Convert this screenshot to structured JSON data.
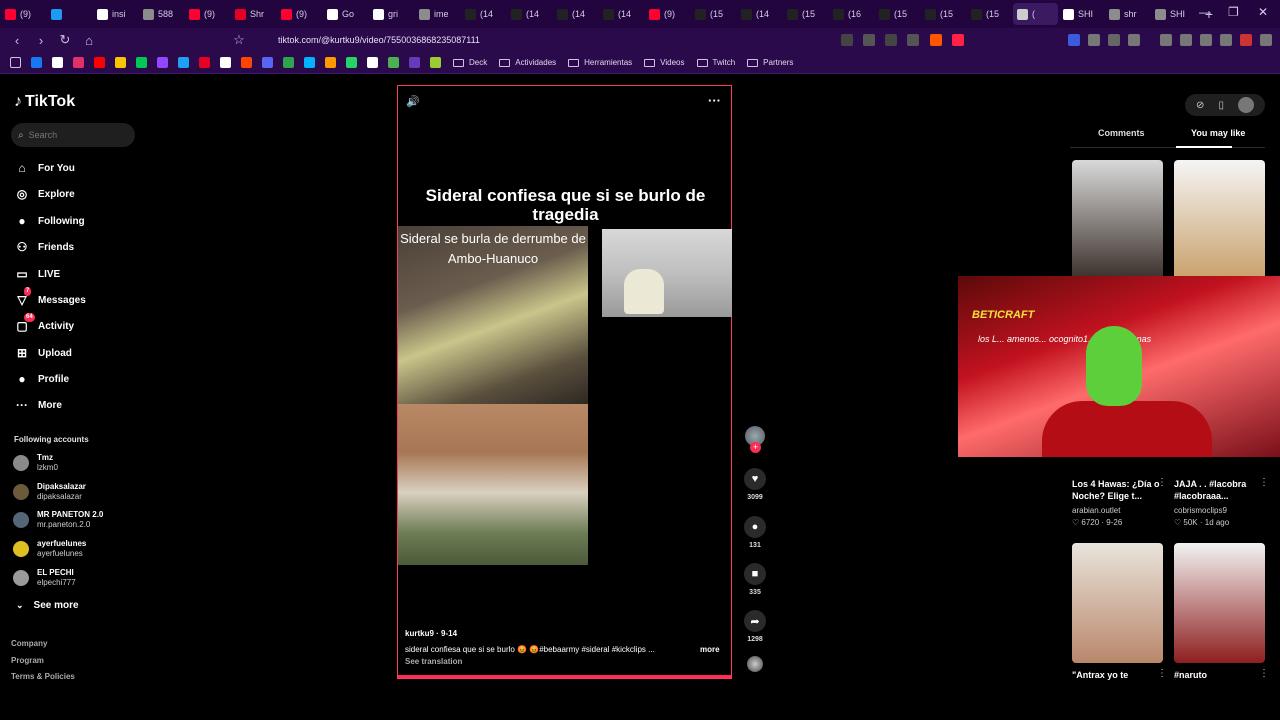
{
  "browser": {
    "tabs": [
      {
        "label": "(9)",
        "color": "#ff0033",
        "active": false
      },
      {
        "label": "",
        "color": "#1d9bf0",
        "active": false
      },
      {
        "label": "insi",
        "color": "#ffffff",
        "active": false
      },
      {
        "label": "588",
        "color": "#8c8c8c",
        "active": false
      },
      {
        "label": "(9)",
        "color": "#ff0033",
        "active": false
      },
      {
        "label": "Shr",
        "color": "#e60023",
        "active": false
      },
      {
        "label": "(9)",
        "color": "#ff0033",
        "active": false
      },
      {
        "label": "Go",
        "color": "#ffffff",
        "active": false
      },
      {
        "label": "gri",
        "color": "#ffffff",
        "active": false
      },
      {
        "label": "ime",
        "color": "#8c8c8c",
        "active": false
      },
      {
        "label": "(14",
        "color": "#222222",
        "active": false
      },
      {
        "label": "(14",
        "color": "#222222",
        "active": false
      },
      {
        "label": "(14",
        "color": "#222222",
        "active": false
      },
      {
        "label": "(14",
        "color": "#222222",
        "active": false
      },
      {
        "label": "(9)",
        "color": "#ff0033",
        "active": false
      },
      {
        "label": "(15",
        "color": "#222222",
        "active": false
      },
      {
        "label": "(14",
        "color": "#222222",
        "active": false
      },
      {
        "label": "(15",
        "color": "#222222",
        "active": false
      },
      {
        "label": "(16",
        "color": "#222222",
        "active": false
      },
      {
        "label": "(15",
        "color": "#222222",
        "active": false
      },
      {
        "label": "(15",
        "color": "#222222",
        "active": false
      },
      {
        "label": "(15",
        "color": "#222222",
        "active": false
      },
      {
        "label": "(",
        "color": "#cccccc",
        "active": true
      },
      {
        "label": "SHI",
        "color": "#ffffff",
        "active": false
      },
      {
        "label": "shr",
        "color": "#8c8c8c",
        "active": false
      },
      {
        "label": "SHI",
        "color": "#8c8c8c",
        "active": false
      }
    ],
    "new_tab": "+",
    "window_controls": {
      "minimize": "—",
      "restore": "❐",
      "close": "✕"
    },
    "url": "tiktok.com/@kurtku9/video/7550036868235087111",
    "bookmarks_icons": [
      "#1877f2",
      "#ffffff",
      "#e1306c",
      "#ff0000",
      "#f7c600",
      "#00c853",
      "#9146ff",
      "#1da1f2",
      "#e60023",
      "#ffffff",
      "#ff4500",
      "#5865f2",
      "#2ea44f",
      "#00b2ff",
      "#ff9900",
      "#25d366",
      "#ffffff",
      "#4caf50",
      "#673ab7",
      "#9acd32"
    ],
    "bookmark_folders": [
      "Deck",
      "Actividades",
      "Herramientas",
      "Videos",
      "Twitch",
      "Partners"
    ]
  },
  "tiktok": {
    "logo": "TikTok",
    "search_placeholder": "Search",
    "nav": [
      {
        "label": "For You",
        "icon": "⌂",
        "badge": ""
      },
      {
        "label": "Explore",
        "icon": "◎",
        "badge": ""
      },
      {
        "label": "Following",
        "icon": "●",
        "badge": ""
      },
      {
        "label": "Friends",
        "icon": "⚇",
        "badge": ""
      },
      {
        "label": "LIVE",
        "icon": "▭",
        "badge": ""
      },
      {
        "label": "Messages",
        "icon": "▽",
        "badge": "7"
      },
      {
        "label": "Activity",
        "icon": "▢",
        "badge": "64"
      },
      {
        "label": "Upload",
        "icon": "⊞",
        "badge": ""
      },
      {
        "label": "Profile",
        "icon": "●",
        "badge": ""
      },
      {
        "label": "More",
        "icon": "···",
        "badge": ""
      }
    ],
    "following_header": "Following accounts",
    "following": [
      {
        "name": "Tmz",
        "handle": "lzkm0",
        "color": "#8a8a8a"
      },
      {
        "name": "Dipaksalazar",
        "handle": "dipaksalazar",
        "color": "#6b5a3c"
      },
      {
        "name": "MR PANETON 2.0",
        "handle": "mr.paneton.2.0",
        "color": "#556677"
      },
      {
        "name": "ayerfuelunes",
        "handle": "ayerfuelunes",
        "color": "#e0c020"
      },
      {
        "name": "EL PECHI",
        "handle": "elpechi777",
        "color": "#9a9a9a"
      }
    ],
    "see_more": "See more",
    "footer": [
      "Company",
      "Program",
      "Terms & Policies"
    ]
  },
  "video": {
    "title": "Sideral confiesa que si se burlo de tragedia",
    "clip_caption": "Sideral se burla de derrumbe de Ambo-Huanuco",
    "author": "kurtku9 · 9-14",
    "description": "sideral confiesa que si se burlo 😡 😡#bebaarmy  #sideral  #kickclips  ...",
    "more": "more",
    "see_translation": "See translation",
    "sound_icon": "🔊",
    "more_icon": "···"
  },
  "actions": [
    {
      "name": "like",
      "icon": "♥",
      "count": "3099"
    },
    {
      "name": "comment",
      "icon": "●",
      "count": "131"
    },
    {
      "name": "save",
      "icon": "■",
      "count": "335"
    },
    {
      "name": "share",
      "icon": "➦",
      "count": "1298"
    }
  ],
  "right_panel": {
    "tabs": [
      "Comments",
      "You may like"
    ],
    "active_tab": "You may like",
    "cards": [
      {
        "title": "",
        "author": "",
        "stats": "",
        "colors": [
          "#d9d9d9",
          "#3a2f2a"
        ]
      },
      {
        "title": "",
        "author": "",
        "stats": "",
        "colors": [
          "#f5f5f5",
          "#c9a06a"
        ]
      },
      {
        "title": "Los 4 Hawas: ¿Día o Noche? Elige t...",
        "author": "arabian.outlet",
        "stats": "♡ 6720 · 9-26",
        "colors": [
          "#444",
          "#222"
        ]
      },
      {
        "title": "JAJA . . #lacobra #lacobraaa...",
        "author": "cobrismoclips9",
        "stats": "♡ 50K · 1d ago",
        "colors": [
          "#444",
          "#222"
        ]
      },
      {
        "title": "\"Antrax yo te",
        "author": "",
        "stats": "",
        "colors": [
          "#e9e4dc",
          "#b9876b"
        ]
      },
      {
        "title": "#naruto",
        "author": "",
        "stats": "",
        "colors": [
          "#f3f3f3",
          "#8e1f1f"
        ]
      }
    ]
  },
  "webcam": {
    "logo": "BETICRAFT",
    "text": "los L... amenos... ocognito1... black... fenas"
  }
}
